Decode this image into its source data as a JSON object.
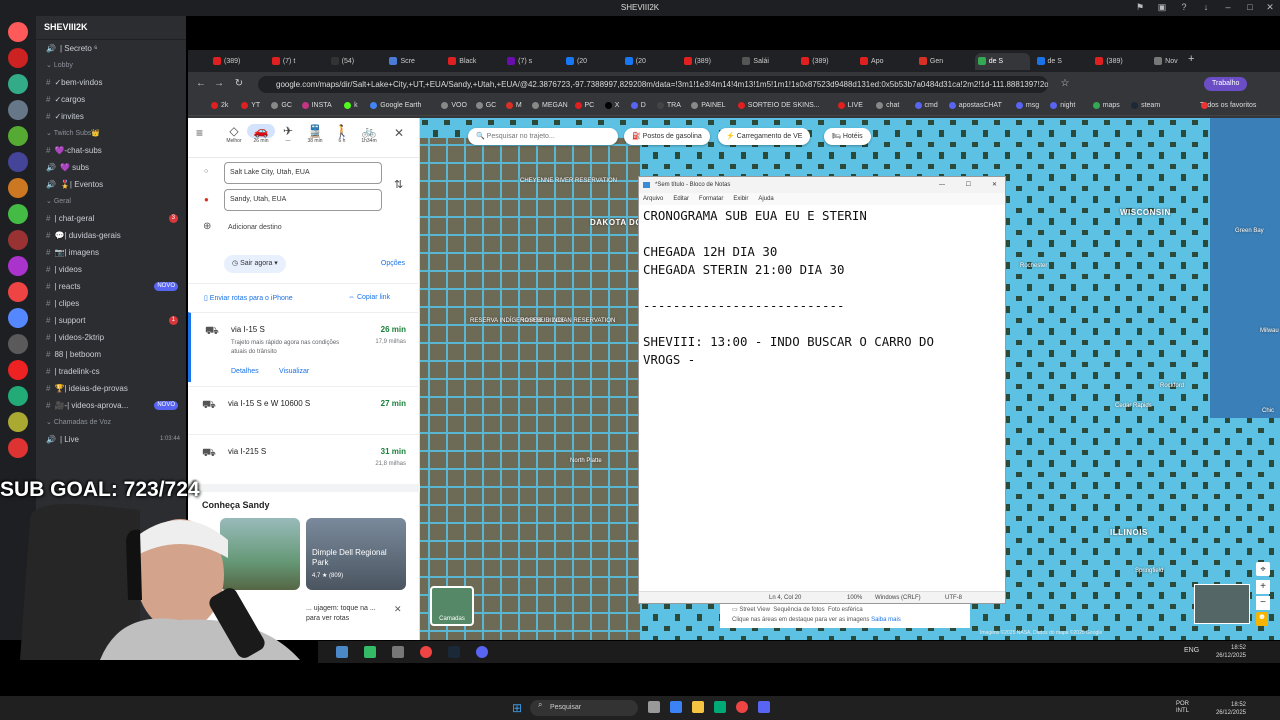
{
  "window_title": "SHEVIII2K",
  "discord": {
    "server_name": "SHEVIII2K",
    "channels": [
      {
        "label": "| Secreto ⁶",
        "type": "voice"
      },
      {
        "label": "Lobby",
        "type": "category"
      },
      {
        "label": "✓bem-vindos",
        "type": "text"
      },
      {
        "label": "✓cargos",
        "type": "text"
      },
      {
        "label": "✓invites",
        "type": "text"
      },
      {
        "label": "Twitch Subs👑",
        "type": "category"
      },
      {
        "label": "💜-chat-subs",
        "type": "text"
      },
      {
        "label": "💜 subs",
        "type": "voice"
      },
      {
        "label": "🎖️| Eventos",
        "type": "voice"
      },
      {
        "label": "Geral",
        "type": "category"
      },
      {
        "label": "| chat-geral",
        "type": "text",
        "badge": "3"
      },
      {
        "label": "💬| duvidas-gerais",
        "type": "text"
      },
      {
        "label": "📷| imagens",
        "type": "text"
      },
      {
        "label": "| videos",
        "type": "text"
      },
      {
        "label": "| reacts",
        "type": "text",
        "badge": "NOVO"
      },
      {
        "label": "| clipes",
        "type": "text"
      },
      {
        "label": "| support",
        "type": "text",
        "badge": "1"
      },
      {
        "label": "| videos-2ktrip",
        "type": "text"
      },
      {
        "label": "88 | betboom",
        "type": "text"
      },
      {
        "label": "| tradelink-cs",
        "type": "text"
      },
      {
        "label": "🏆| ideias-de-provas",
        "type": "text"
      },
      {
        "label": "🎥-| videos-aprova...",
        "type": "text",
        "badge": "NOVO"
      },
      {
        "label": "Chamadas de Voz",
        "type": "category"
      },
      {
        "label": "| Live",
        "type": "voice",
        "extra": "1:03:44"
      }
    ]
  },
  "browser": {
    "tabs": [
      {
        "label": "(389)",
        "color": "#e02020"
      },
      {
        "label": "(7) t",
        "color": "#e02020"
      },
      {
        "label": "(54)",
        "color": "#333"
      },
      {
        "label": "Scre",
        "color": "#4a7bd6"
      },
      {
        "label": "Black",
        "color": "#e02020"
      },
      {
        "label": "(7) s",
        "color": "#6a0dad"
      },
      {
        "label": "(20",
        "color": "#1877f2"
      },
      {
        "label": "(20",
        "color": "#1877f2"
      },
      {
        "label": "(389)",
        "color": "#e02020"
      },
      {
        "label": "Salái",
        "color": "#555"
      },
      {
        "label": "(389)",
        "color": "#e02020"
      },
      {
        "label": "Apo",
        "color": "#e02020"
      },
      {
        "label": "Gen",
        "color": "#d93025"
      },
      {
        "label": "de S",
        "color": "#34a853",
        "active": true
      },
      {
        "label": "de S",
        "color": "#1a73e8"
      },
      {
        "label": "(389)",
        "color": "#e02020"
      },
      {
        "label": "Nov",
        "color": "#777"
      }
    ],
    "url": "google.com/maps/dir/Salt+Lake+City,+UT,+EUA/Sandy,+Utah,+EUA/@42.3876723,-97.7388997,829208m/data=!3m1!1e3!4m14!4m13!1m5!1m1!1s0x87523d9488d131ed:0x5b53b7a0484d31ca!2m2!1d-111.8881397!2d...",
    "profile_label": "Trabalho",
    "bookmarks": [
      {
        "label": "2k",
        "color": "#e02020"
      },
      {
        "label": "YT",
        "color": "#e02020"
      },
      {
        "label": "GC",
        "color": "#888"
      },
      {
        "label": "INSTA",
        "color": "#c13584"
      },
      {
        "label": "k",
        "color": "#53fc18"
      },
      {
        "label": "Google Earth",
        "color": "#4285f4"
      },
      {
        "label": "VOO",
        "color": "#888"
      },
      {
        "label": "GC",
        "color": "#888"
      },
      {
        "label": "M",
        "color": "#d93025"
      },
      {
        "label": "MEGAN",
        "color": "#888"
      },
      {
        "label": "PC",
        "color": "#e02020"
      },
      {
        "label": "X",
        "color": "#000"
      },
      {
        "label": "D",
        "color": "#5865f2"
      },
      {
        "label": "TRA",
        "color": "#444"
      },
      {
        "label": "PAINEL",
        "color": "#888"
      },
      {
        "label": "SORTEIO DE SKINS...",
        "color": "#e02020"
      },
      {
        "label": "LIVE",
        "color": "#e02020"
      },
      {
        "label": "chat",
        "color": "#888"
      },
      {
        "label": "cmd",
        "color": "#5865f2"
      },
      {
        "label": "apostasCHAT",
        "color": "#5865f2"
      },
      {
        "label": "msg",
        "color": "#5865f2"
      },
      {
        "label": "night",
        "color": "#5865f2"
      },
      {
        "label": "maps",
        "color": "#34a853"
      },
      {
        "label": "steam",
        "color": "#1b2838"
      }
    ],
    "bookmarks_all": "Todos os favoritos"
  },
  "maps": {
    "modes": [
      {
        "label": "Melhor",
        "icon": "◇"
      },
      {
        "label": "26 min",
        "icon": "🚗",
        "active": true
      },
      {
        "label": "—",
        "icon": "✈"
      },
      {
        "label": "38 min",
        "icon": "🚆"
      },
      {
        "label": "6 h",
        "icon": "🚶"
      },
      {
        "label": "1h34m",
        "icon": "🚲"
      }
    ],
    "origin": "Salt Lake City, Utah, EUA",
    "destination": "Sandy, Utah, EUA",
    "add_destination": "Adicionar destino",
    "depart": "Sair agora",
    "options": "Opções",
    "send_phone": "Enviar rotas para o iPhone",
    "copy_link": "Copiar link",
    "routes": [
      {
        "name": "via I-15 S",
        "time": "26 min",
        "km": "17,9 milhas",
        "desc": "Trajeto mais rápido agora nas condições atuais do trânsito",
        "details": "Detalhes",
        "view": "Visualizar"
      },
      {
        "name": "via I-15 S e W 10600 S",
        "time": "27 min",
        "km": ""
      },
      {
        "name": "via I-215 S",
        "time": "31 min",
        "km": "21,8 milhas"
      }
    ],
    "explore": "Conheça Sandy",
    "place_name": "Dimple Dell Regional Park",
    "place_rating": "4,7 ★ (809)",
    "tip": "... ujagem: toque na ... para ver rotas",
    "search_placeholder": "Pesquisar no trajeto...",
    "chips": [
      "Postos de gasolina",
      "Carregamento de VE",
      "Hotéis"
    ],
    "layers_label": "Camadas",
    "map_labels": [
      "DAKOTA DO SUL",
      "WISCONSIN",
      "ILLINOIS",
      "CHEYENNE RIVER RESERVATION",
      "RESERVA INDÍGENA PINE RIDGE",
      "ROSEBUD INDIAN RESERVATION",
      "Milwau",
      "Chic",
      "Rockford",
      "Cedar Rapids",
      "Rochester",
      "Green Bay",
      "Springfield",
      "North Platte"
    ],
    "footer_streetview": "Street View",
    "footer_photos": "Sequência de fotos",
    "footer_spherical": "Foto esférica",
    "footer_note": "Clique nas áreas em destaque para ver as imagens",
    "footer_more": "Saiba mais",
    "copyright": "Imagens ©2025 NASA, Dados do mapa ©2025 Google"
  },
  "notepad": {
    "title": "*Sem título - Bloco de Notas",
    "menu": [
      "Arquivo",
      "Editar",
      "Formatar",
      "Exibir",
      "Ajuda"
    ],
    "text": "CRONOGRAMA SUB EUA EU E STERIN\n\nCHEGADA 12H DIA 30\nCHEGADA STERIN 21:00 DIA 30\n\n---------------------------\n\nSHEVIII: 13:00 - INDO BUSCAR O CARRO DO\nVROGS -",
    "status_pos": "Ln 4, Col 20",
    "status_zoom": "100%",
    "status_eol": "Windows (CRLF)",
    "status_enc": "UTF-8"
  },
  "overlay": {
    "sub_goal": "SUB GOAL: 723/724"
  },
  "taskbar": {
    "search": "Pesquisar",
    "lang_top": "POR",
    "lang_bottom": "INTL",
    "time": "18:52",
    "date": "26/12/2025",
    "inner_lang": "ENG",
    "inner_time": "18:52",
    "inner_date": "26/12/2025"
  },
  "colors": {
    "discord_bg": "#2b2d31",
    "map_water": "#5fc0df",
    "maps_accent": "#1a73e8",
    "route_green": "#188038"
  }
}
